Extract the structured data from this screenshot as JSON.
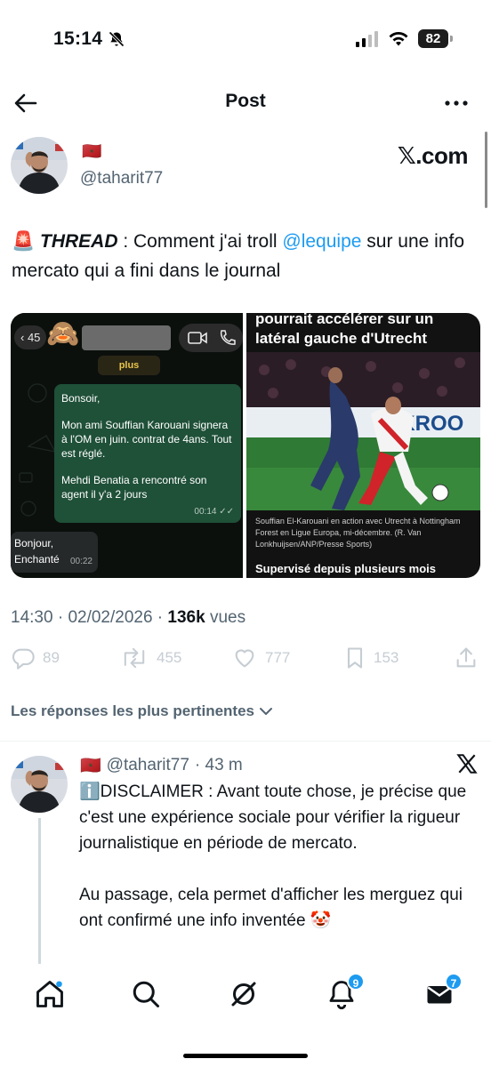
{
  "status_bar": {
    "time": "15:14",
    "battery": "82"
  },
  "header": {
    "title": "Post"
  },
  "author": {
    "flag": "🇲🇦",
    "handle": "@taharit77",
    "brand": "𝕏.com"
  },
  "tweet": {
    "emoji": "🚨",
    "thread_label": "THREAD",
    "text_before": " : Comment j'ai troll ",
    "mention": "@lequipe",
    "text_after": " sur une info mercato qui a fini dans le journal"
  },
  "media": {
    "chat": {
      "back_count": "45",
      "plus_label": "plus",
      "msg_out_1": "Bonsoir,",
      "msg_out_2": "Mon ami Souffian Karouani signera à l'OM en juin. contrat de 4ans. Tout est réglé.",
      "msg_out_3": "Mehdi Benatia a rencontré son agent il y'a 2 jours",
      "msg_out_time": "00:14",
      "msg_in": "Bonjour, Enchanté",
      "msg_in_time": "00:22"
    },
    "article": {
      "headline": "pourrait accélérer sur un latéral gauche d'Utrecht",
      "ad_board": "NKROO",
      "caption": "Souffian El-Karouani en action avec Utrecht à Nottingham Forest en Ligue Europa, mi-décembre. (R. Van Lonkhuijsen/ANP/Presse Sports)",
      "subheading": "Supervisé depuis plusieurs mois"
    }
  },
  "meta": {
    "time": "14:30",
    "date": "02/02/2026",
    "views": "136k",
    "views_label": "vues"
  },
  "actions": {
    "replies": "89",
    "reposts": "455",
    "likes": "777",
    "bookmarks": "153"
  },
  "replies_sort": {
    "label": "Les réponses les plus pertinentes"
  },
  "reply": {
    "flag": "🇲🇦",
    "handle": "@taharit77",
    "time": "· 43 m",
    "info_emoji": "ℹ️",
    "paragraph_1": "DISCLAIMER : Avant toute chose, je précise que c'est une expérience sociale pour vérifier la rigueur journalistique en période de mercato.",
    "paragraph_2": "Au passage, cela permet d'afficher les merguez qui ont confirmé une info inventée 🤡"
  },
  "bottom_nav": {
    "notifications_badge": "9",
    "messages_badge": "7"
  },
  "colors": {
    "accent": "#1d9bf0",
    "text": "#0f1419",
    "secondary": "#536471",
    "whatsapp_bubble": "#1f5038"
  }
}
